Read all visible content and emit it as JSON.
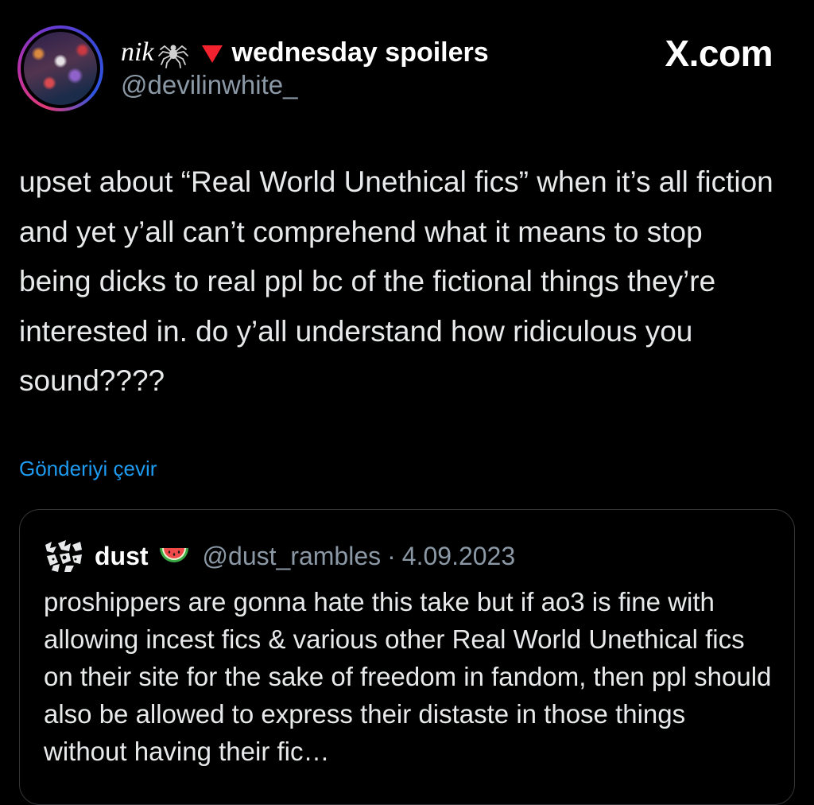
{
  "tweet": {
    "author": {
      "name_italic": "nik",
      "name_bold": "wednesday spoilers",
      "handle": "@devilinwhite_",
      "icons": [
        "avatar",
        "spider-icon",
        "red-triangle-icon"
      ]
    },
    "brand": "X.com",
    "text": "upset about “Real World Unethical fics” when it’s all fiction and yet y’all can’t comprehend what it means to stop being dicks to real ppl bc of the fictional things they’re interested in. do y’all understand how ridiculous you sound????",
    "translate_label": "Gönderiyi çevir"
  },
  "quote": {
    "name": "dust",
    "handle": "@dust_rambles",
    "separator": "·",
    "date": "4.09.2023",
    "text": "proshippers are gonna hate this take but if ao3 is fine with allowing incest fics & various other Real World Unethical fics on their site for the sake of freedom in fandom, then ppl should also be allowed to express their distaste in those things without having their fic…",
    "icons": [
      "quote-avatar",
      "watermelon-icon"
    ]
  },
  "colors": {
    "background": "#000000",
    "text": "#e7e9ea",
    "muted": "#8b98a5",
    "link": "#1d9bf0",
    "border": "#333639",
    "triangle": "#f4212e"
  }
}
